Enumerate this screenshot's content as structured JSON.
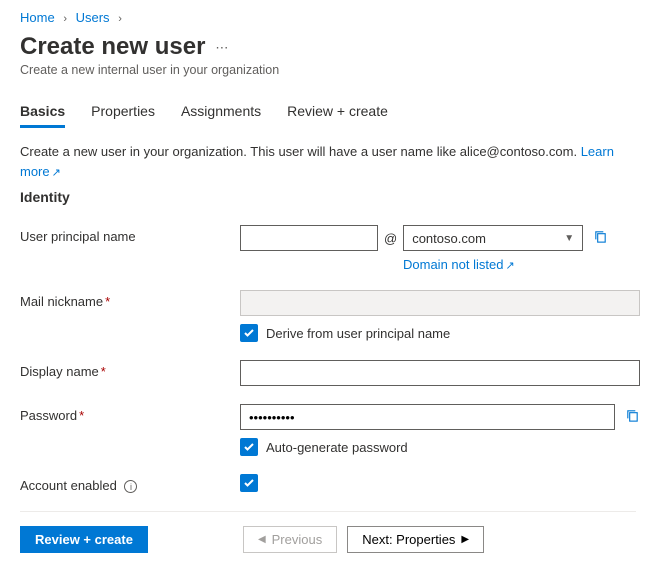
{
  "breadcrumb": {
    "home": "Home",
    "users": "Users"
  },
  "page": {
    "title": "Create new user",
    "subtitle": "Create a new internal user in your organization"
  },
  "tabs": {
    "basics": "Basics",
    "properties": "Properties",
    "assignments": "Assignments",
    "review": "Review + create"
  },
  "description": {
    "text": "Create a new user in your organization. This user will have a user name like alice@contoso.com.",
    "learn_more": "Learn more"
  },
  "section": {
    "identity": "Identity"
  },
  "fields": {
    "upn_label": "User principal name",
    "upn_value": "",
    "upn_at": "@",
    "upn_domain": "contoso.com",
    "domain_not_listed": "Domain not listed",
    "mail_nickname_label": "Mail nickname",
    "mail_nickname_value": "",
    "derive_label": "Derive from user principal name",
    "display_name_label": "Display name",
    "display_name_value": "",
    "password_label": "Password",
    "password_value": "••••••••••",
    "auto_gen_label": "Auto-generate password",
    "account_enabled_label": "Account enabled"
  },
  "footer": {
    "review": "Review + create",
    "previous": "Previous",
    "next": "Next: Properties"
  }
}
